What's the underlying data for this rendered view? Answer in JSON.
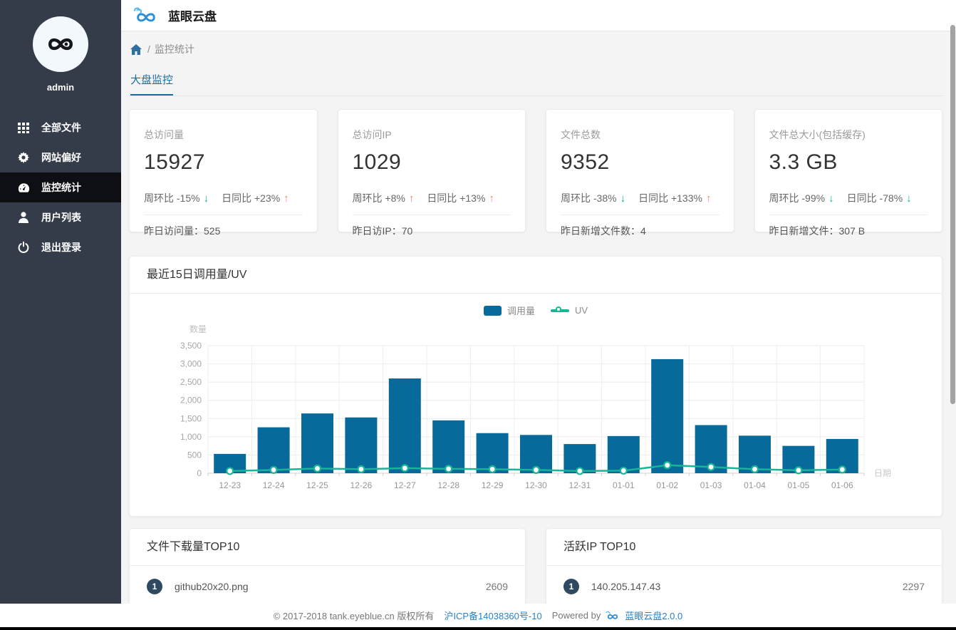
{
  "app": {
    "title": "蓝眼云盘"
  },
  "sidebar": {
    "username": "admin",
    "items": [
      {
        "icon": "grid-icon",
        "label": "全部文件",
        "active": false
      },
      {
        "icon": "gear-icon",
        "label": "网站偏好",
        "active": false
      },
      {
        "icon": "gauge-icon",
        "label": "监控统计",
        "active": true
      },
      {
        "icon": "user-icon",
        "label": "用户列表",
        "active": false
      },
      {
        "icon": "power-icon",
        "label": "退出登录",
        "active": false
      }
    ]
  },
  "breadcrumb": {
    "separator": "/",
    "current": "监控统计"
  },
  "tabs": [
    {
      "label": "大盘监控",
      "active": true
    }
  ],
  "stat_cards": [
    {
      "label": "总访问量",
      "value": "15927",
      "week_label": "周环比 -15%",
      "week_dir": "down",
      "day_label": "日同比 +23%",
      "day_dir": "up",
      "footer_label": "昨日访问量：",
      "footer_value": "525"
    },
    {
      "label": "总访问IP",
      "value": "1029",
      "week_label": "周环比 +8%",
      "week_dir": "up",
      "day_label": "日同比 +13%",
      "day_dir": "up",
      "footer_label": "昨日访IP：",
      "footer_value": "70"
    },
    {
      "label": "文件总数",
      "value": "9352",
      "week_label": "周环比 -38%",
      "week_dir": "down",
      "day_label": "日同比 +133%",
      "day_dir": "up",
      "footer_label": "昨日新增文件数：",
      "footer_value": "4"
    },
    {
      "label": "文件总大小(包括缓存)",
      "value": "3.3 GB",
      "week_label": "周环比 -99%",
      "week_dir": "down",
      "day_label": "日同比 -78%",
      "day_dir": "down",
      "footer_label": "昨日新增文件：",
      "footer_value": "307 B"
    }
  ],
  "chart_data": {
    "type": "bar",
    "title": "最近15日调用量/UV",
    "categories": [
      "12-23",
      "12-24",
      "12-25",
      "12-26",
      "12-27",
      "12-28",
      "12-29",
      "12-30",
      "12-31",
      "01-01",
      "01-02",
      "01-03",
      "01-04",
      "01-05",
      "01-06"
    ],
    "series": [
      {
        "name": "调用量",
        "type": "bar",
        "color": "#086a9a",
        "values": [
          530,
          1260,
          1640,
          1530,
          2600,
          1450,
          1100,
          1050,
          800,
          1020,
          3130,
          1320,
          1030,
          750,
          940
        ]
      },
      {
        "name": "UV",
        "type": "line",
        "color": "#18b597",
        "values": [
          60,
          90,
          130,
          110,
          140,
          120,
          110,
          90,
          60,
          70,
          220,
          170,
          110,
          80,
          100
        ]
      }
    ],
    "xlabel": "日期",
    "ylabel": "数量",
    "ylim": [
      0,
      3500
    ],
    "ytick_step": 500,
    "grid": true,
    "legend_position": "top-center"
  },
  "top_lists": [
    {
      "title": "文件下载量TOP10",
      "rows": [
        {
          "rank": "1",
          "name": "github20x20.png",
          "value": "2609"
        }
      ]
    },
    {
      "title": "活跃IP TOP10",
      "rows": [
        {
          "rank": "1",
          "name": "140.205.147.43",
          "value": "2297"
        }
      ]
    }
  ],
  "footer": {
    "copyright": "© 2017-2018 tank.eyeblue.cn 版权所有",
    "icp": "沪ICP备14038360号-10",
    "powered_by": "Powered by",
    "brand": "蓝眼云盘2.0.0"
  },
  "colors": {
    "accent": "#1b6d9e",
    "bar": "#086a9a",
    "line": "#18b597",
    "trend_up": "#f0876d",
    "trend_down": "#13b29c",
    "sidebar_bg": "#343b49",
    "sidebar_active_bg": "#0d0f14",
    "badge": "#2e4960",
    "link": "#2981c4"
  }
}
